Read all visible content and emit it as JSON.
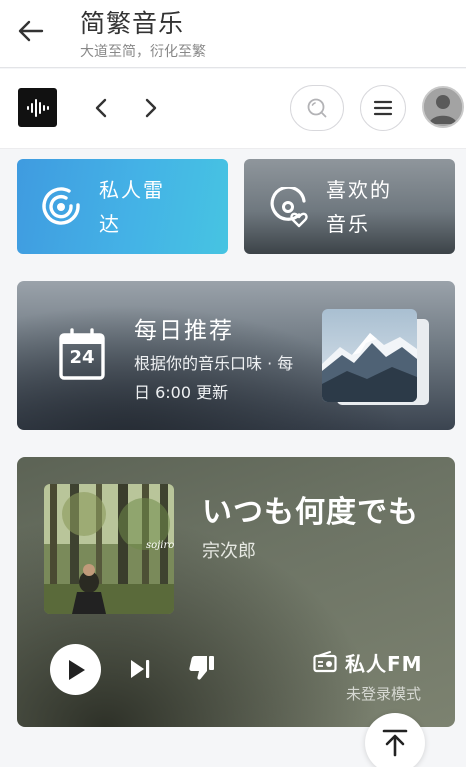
{
  "header": {
    "title": "简繁音乐",
    "subtitle": "大道至简，衍化至繁"
  },
  "toolbar": {
    "logo_icon": "waveform-icon",
    "prev_icon": "chevron-left-icon",
    "next_icon": "chevron-right-icon",
    "search_icon": "search-icon",
    "menu_icon": "hamburger-icon",
    "avatar_icon": "user-avatar-icon"
  },
  "quick_cards": [
    {
      "label": "私人雷达",
      "icon": "radar-icon"
    },
    {
      "label": "喜欢的音乐",
      "icon": "liked-music-icon"
    }
  ],
  "daily": {
    "title": "每日推荐",
    "description": "根据你的音乐口味 · 每日 6:00 更新",
    "calendar_day": "24",
    "icon": "calendar-icon"
  },
  "fm": {
    "song_title": "いつも何度でも",
    "artist": "宗次郎",
    "cover_text": "sojiro",
    "badge_label": "私人FM",
    "badge_icon": "radio-icon",
    "mode": "未登录模式",
    "controls": [
      "play-icon",
      "skip-next-icon",
      "dislike-icon"
    ]
  },
  "scroll_top_icon": "arrow-to-top-icon",
  "colors": {
    "radar_card": "#44b2e6",
    "liked_card": "#6f787f",
    "daily_card": "#6f7982",
    "fm_card": "#6c7364",
    "background": "#f5f6f8"
  }
}
